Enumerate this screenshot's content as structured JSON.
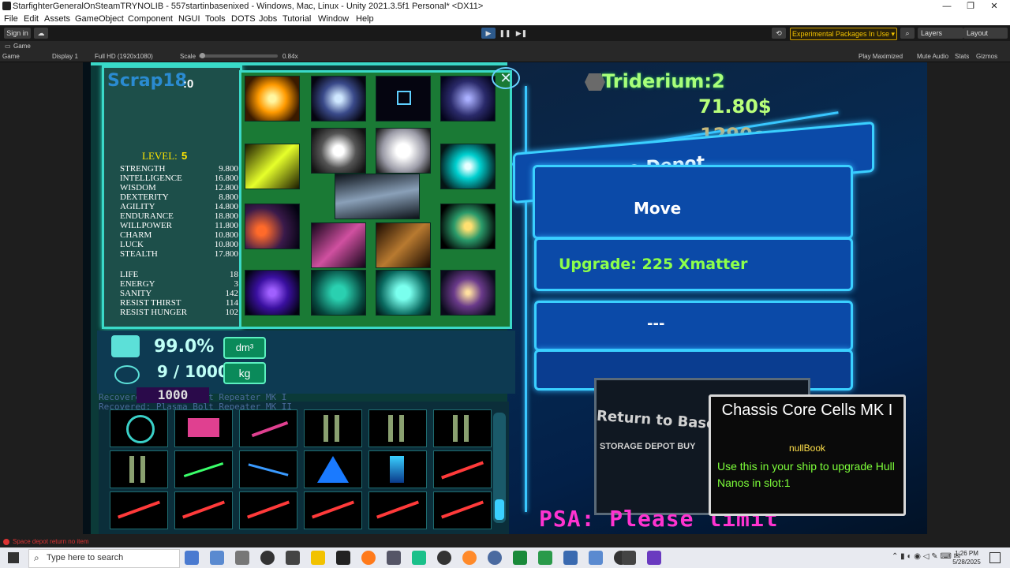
{
  "window": {
    "title": "StarfighterGeneralOnSteamTRYNOLIB - 557startinbasenixed - Windows, Mac, Linux - Unity 2021.3.5f1 Personal* <DX11>",
    "controls": [
      "—",
      "❐",
      "✕"
    ]
  },
  "menu": [
    "File",
    "Edit",
    "Assets",
    "GameObject",
    "Component",
    "NGUI",
    "Tools",
    "DOTS",
    "Jobs",
    "Tutorial",
    "Window",
    "Help"
  ],
  "toolbar": {
    "signin": "Sign in",
    "experimental": "Experimental Packages In Use ▾",
    "layers": "Layers",
    "layout": "Layout"
  },
  "gametab": {
    "label": "Game",
    "display_mode": "Game",
    "display": "Display 1",
    "resolution": "Full HD (1920x1080)",
    "scale_label": "Scale",
    "scale_value": "0.84x",
    "play_maximized": "Play Maximized",
    "mute_audio": "Mute Audio",
    "stats": "Stats",
    "gizmos": "Gizmos"
  },
  "game": {
    "scrap": "Scrap18",
    "scrap_count": ":0",
    "level_label": "LEVEL:",
    "level_value": "5",
    "stats": [
      {
        "name": "Strength",
        "value": "9.800"
      },
      {
        "name": "Intelligence",
        "value": "16.800"
      },
      {
        "name": "Wisdom",
        "value": "12.800"
      },
      {
        "name": "Dexterity",
        "value": "8.800"
      },
      {
        "name": "Agility",
        "value": "14.800"
      },
      {
        "name": "Endurance",
        "value": "18.800"
      },
      {
        "name": "Willpower",
        "value": "11.800"
      },
      {
        "name": "Charm",
        "value": "10.800"
      },
      {
        "name": "Luck",
        "value": "10.800"
      },
      {
        "name": "Stealth",
        "value": "17.800"
      }
    ],
    "vitals": [
      {
        "name": "Life",
        "value": "18"
      },
      {
        "name": "Energy",
        "value": "3"
      },
      {
        "name": "Sanity",
        "value": "142"
      },
      {
        "name": "Resist Thirst",
        "value": "114"
      },
      {
        "name": "Resist Hunger",
        "value": "102"
      }
    ],
    "capacity_percent": "99.0%",
    "capacity_unit": "dm³",
    "weight": "9 / 1000",
    "weight_unit": "kg",
    "max_weight": "1000",
    "triderium": "Triderium:2",
    "money": "71.80$",
    "credits": "1290c",
    "buttons": {
      "storage": "Storage Depot",
      "move": "Move",
      "upgrade": "Upgrade: 225 Xmatter",
      "blank": "---",
      "return": "Return to Base",
      "storage_sub": "STORAGE DEPOT BUY"
    },
    "psa": "PSA: Please limit",
    "log_lines": [
      "Recovered: Plasma Bolt Repeater MK I",
      "Recovered: Plasma Bolt Repeater MK II"
    ]
  },
  "tooltip": {
    "title": "Chassis Core Cells MK I",
    "source": "nullBook",
    "desc": "Use this in your ship to upgrade Hull Nanos in slot:1"
  },
  "statusbar": "Space depot return no item",
  "taskbar": {
    "search": "Type here to search",
    "time": "1:26 PM",
    "date": "5/28/2025"
  },
  "colors": {
    "neon_blue": "#39c7ff",
    "neon_green": "#a8ff7a",
    "tooltip_green": "#7dff3a",
    "tooltip_yellow": "#ffe04a",
    "level_yellow": "#ffe600"
  }
}
